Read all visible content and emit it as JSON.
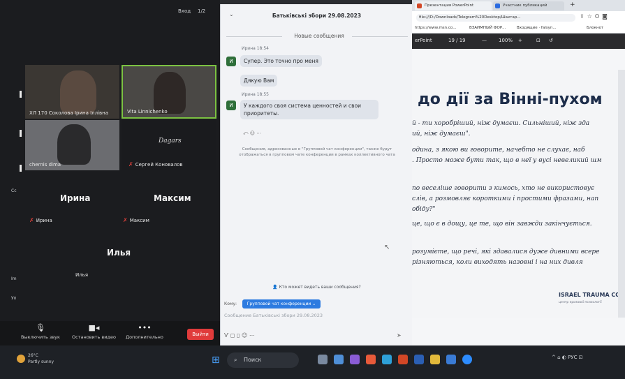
{
  "zoom": {
    "top_left": "Вход",
    "top_right": "1/2",
    "tiles": [
      {
        "name": "ХЛ 170 Соколова Ірина Іллівна"
      },
      {
        "name": "Vita Linnichenko"
      },
      {
        "name": "chernis dima"
      },
      {
        "name": "Сергей Коновалов"
      }
    ],
    "logo_text": "Dagars",
    "big_names": [
      "Ирина",
      "Максим",
      "Илья"
    ],
    "small_names": [
      "Ирина",
      "Максим",
      "Илья"
    ],
    "edge_labels": [
      "Cc",
      "Im",
      "Уп"
    ],
    "toolbar": {
      "mute": "Выключить звук",
      "video": "Остановить видео",
      "more": "Дополнительно",
      "leave": "Выйти"
    }
  },
  "chat": {
    "title": "Батьківські збори 29.08.2023",
    "new_messages": "Новые сообщения",
    "messages": [
      {
        "initial": "И",
        "meta": "Ирина 18:54",
        "bubbles": [
          "Супер. Это точно про меня",
          "Дякую Вам"
        ]
      },
      {
        "initial": "И",
        "meta": "Ирина 18:55",
        "bubbles": [
          "У каждого своя система ценностей и свои приоритеты."
        ]
      }
    ],
    "notice": "Сообщения, адресованные в \"Групповой чат конференции\", также будут отображаться в групповом чате конференции в рамках коллективного чата",
    "who_can_see": "Кто может видеть ваши сообщения?",
    "to_label": "Кому:",
    "to_target": "Групповой чат конференции",
    "input_placeholder": "Сообщение Батьківські збори 29.08.2023"
  },
  "browser": {
    "tabs": [
      "Презентация PowerPoint",
      "Участник публикаций"
    ],
    "address": "file:///D:/Downloads/Telegram%20Desktop/Шахтар...",
    "bookmarks": [
      "https://www.msn.co...",
      "ВЗАИМНЫЙ ФОР...",
      "Входящие · falsyn...",
      "Блокнот"
    ],
    "app_name": "erPoint",
    "page": "19 / 19",
    "zoom": "100%",
    "slide": {
      "title": "до дії за Вінні-пухом",
      "paragraphs": [
        "й - ти хоробріший, ніж думаєш. Сильніший, ніж зда",
        "ий, ніж думаєш\".",
        "одина, з якою ви говорите, начебто не слухає, наб",
        ". Просто може бути так, що в неї у вусі невеликий шм",
        "по веселіше говорити з кимось, хто не використовує",
        " слів, а розмовляє короткими і простими фразами, нап",
        " обідy?\"",
        "це, що є в дощу, це те, що він завжди закінчується.",
        "розумієте, що речі, які здавалися дуже дивними всере",
        "різняються, коли виходять назовні і на них дивля"
      ],
      "brand": "ISRAEL TRAUMA COAL",
      "brand_sub": "центр кризової психології"
    }
  },
  "taskbar": {
    "weather_temp": "26°C",
    "weather_desc": "Partly sunny",
    "search": "Поиск",
    "tray": "^  ⌂  ◐  РУС  ⊡"
  }
}
